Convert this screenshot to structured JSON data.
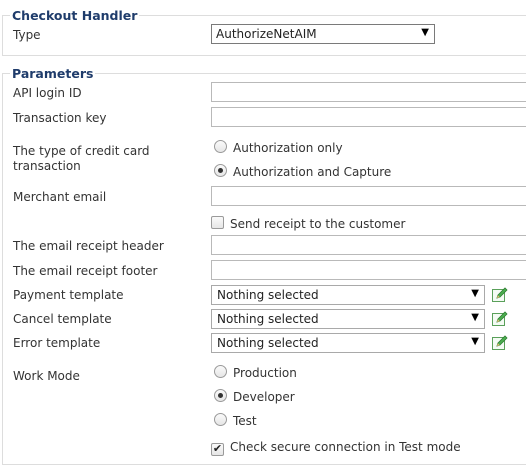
{
  "checkout": {
    "legend": "Checkout Handler",
    "type_label": "Type",
    "type_value": "AuthorizeNetAIM"
  },
  "params": {
    "legend": "Parameters",
    "api_login_label": "API login ID",
    "api_login_value": "",
    "transaction_key_label": "Transaction key",
    "transaction_key_value": "",
    "cc_type_label_line1": "The type of credit card",
    "cc_type_label_line2": "transaction",
    "cc_options": [
      "Authorization only",
      "Authorization and Capture"
    ],
    "cc_selected": "Authorization and Capture",
    "merchant_email_label": "Merchant email",
    "merchant_email_value": "",
    "send_receipt_label": "Send receipt to the customer",
    "send_receipt_checked": false,
    "receipt_header_label": "The email receipt header",
    "receipt_header_value": "",
    "receipt_footer_label": "The email receipt footer",
    "receipt_footer_value": "",
    "payment_template_label": "Payment template",
    "payment_template_value": "Nothing selected",
    "cancel_template_label": "Cancel template",
    "cancel_template_value": "Nothing selected",
    "error_template_label": "Error template",
    "error_template_value": "Nothing selected",
    "work_mode_label": "Work Mode",
    "work_mode_options": [
      "Production",
      "Developer",
      "Test"
    ],
    "work_mode_selected": "Developer",
    "secure_check_label": "Check secure connection in Test mode",
    "secure_check_checked": true
  },
  "icons": {
    "dropdown": "chevron-down-icon",
    "edit": "pencil-edit-icon"
  },
  "colors": {
    "legend": "#1f3c6b",
    "border": "#dddddd",
    "edit_green": "#4caf50"
  }
}
